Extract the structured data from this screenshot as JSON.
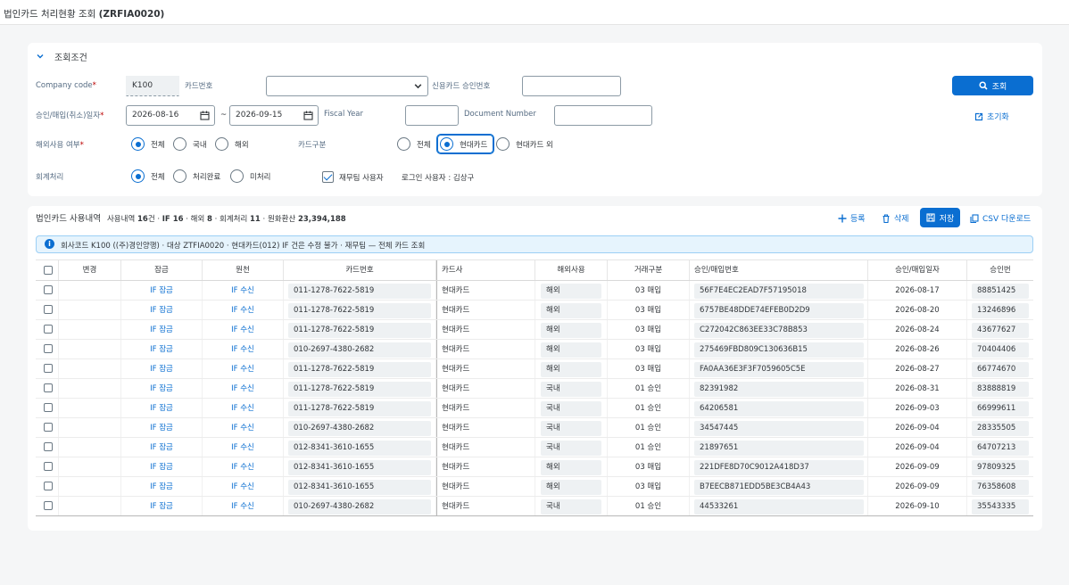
{
  "title": {
    "main": "법인카드 처리현황 조회",
    "code": "(ZRFIA0020)"
  },
  "filter": {
    "section_title": "조회조건",
    "company_label": "Company code",
    "company_value": "K100",
    "card_no_label": "카드번호",
    "card_no_value": "",
    "approval_label": "신용카드 승인번호",
    "approval_value": "",
    "date_label": "승인/매입(취소)일자",
    "date_from": "2026-08-16",
    "date_sep": "~",
    "date_to": "2026-09-15",
    "fiscal_label": "Fiscal Year",
    "fiscal_value": "",
    "docno_label": "Document Number",
    "docno_value": "",
    "overseas_label": "해외사용 여부",
    "overseas_options": [
      "전체",
      "국내",
      "해외"
    ],
    "overseas_selected": "전체",
    "cardtype_label": "카드구분",
    "cardtype_options": [
      "전체",
      "현대카드",
      "현대카드 외"
    ],
    "cardtype_selected": "현대카드",
    "acct_label": "회계처리",
    "acct_options": [
      "전체",
      "처리완료",
      "미처리"
    ],
    "acct_selected": "전체",
    "finance_user_label": "재무팀 사용자",
    "finance_user_checked": true,
    "login_user": "로그인 사용자 : 김상구",
    "search_btn": "조회",
    "reset_btn": "초기화"
  },
  "list": {
    "title": "법인카드 사용내역",
    "summary": {
      "t1": "사용내역 ",
      "total": "16",
      "t2": "건 · ",
      "if_label": "IF ",
      "if_count": "16",
      "t3": " · 해외 ",
      "overseas_count": "8",
      "t4": " · 회계처리 ",
      "acct_count": "11",
      "t5": " · 원화환산 ",
      "krw_total": "23,394,188"
    },
    "actions": {
      "add": "등록",
      "delete": "삭제",
      "save": "저장",
      "csv": "CSV 다운로드"
    },
    "info": "회사코드 K100 ((주)경인양행) · 대상 ZTFIA0020 · 현대카드(012) IF 건은 수정 불가 · 재무팀 — 전체 카드 조회",
    "columns": [
      "",
      "변경",
      "잠금",
      "원천",
      "카드번호",
      "카드사",
      "해외사용",
      "거래구분",
      "승인/매입번호",
      "승인/매입일자",
      "승인번"
    ],
    "rows": [
      {
        "lock": "IF 잠금",
        "src": "IF 수신",
        "card": "011-1278-7622-5819",
        "issuer": "현대카드",
        "ovs": "해외",
        "type": "03 매입",
        "apno": "56F7E4EC2EAD7F57195018",
        "date": "2026-08-17",
        "apv": "88851425"
      },
      {
        "lock": "IF 잠금",
        "src": "IF 수신",
        "card": "011-1278-7622-5819",
        "issuer": "현대카드",
        "ovs": "해외",
        "type": "03 매입",
        "apno": "6757BE48DDE74EFEB0D2D9",
        "date": "2026-08-20",
        "apv": "13246896"
      },
      {
        "lock": "IF 잠금",
        "src": "IF 수신",
        "card": "011-1278-7622-5819",
        "issuer": "현대카드",
        "ovs": "해외",
        "type": "03 매입",
        "apno": "C272042C863EE33C78B853",
        "date": "2026-08-24",
        "apv": "43677627"
      },
      {
        "lock": "IF 잠금",
        "src": "IF 수신",
        "card": "010-2697-4380-2682",
        "issuer": "현대카드",
        "ovs": "해외",
        "type": "03 매입",
        "apno": "275469FBD809C130636B15",
        "date": "2026-08-26",
        "apv": "70404406"
      },
      {
        "lock": "IF 잠금",
        "src": "IF 수신",
        "card": "011-1278-7622-5819",
        "issuer": "현대카드",
        "ovs": "해외",
        "type": "03 매입",
        "apno": "FA0AA36E3F3F7059605C5E",
        "date": "2026-08-27",
        "apv": "66774670"
      },
      {
        "lock": "IF 잠금",
        "src": "IF 수신",
        "card": "011-1278-7622-5819",
        "issuer": "현대카드",
        "ovs": "국내",
        "type": "01 승인",
        "apno": "82391982",
        "date": "2026-08-31",
        "apv": "83888819"
      },
      {
        "lock": "IF 잠금",
        "src": "IF 수신",
        "card": "011-1278-7622-5819",
        "issuer": "현대카드",
        "ovs": "국내",
        "type": "01 승인",
        "apno": "64206581",
        "date": "2026-09-03",
        "apv": "66999611"
      },
      {
        "lock": "IF 잠금",
        "src": "IF 수신",
        "card": "010-2697-4380-2682",
        "issuer": "현대카드",
        "ovs": "국내",
        "type": "01 승인",
        "apno": "34547445",
        "date": "2026-09-04",
        "apv": "28335505"
      },
      {
        "lock": "IF 잠금",
        "src": "IF 수신",
        "card": "012-8341-3610-1655",
        "issuer": "현대카드",
        "ovs": "국내",
        "type": "01 승인",
        "apno": "21897651",
        "date": "2026-09-04",
        "apv": "64707213"
      },
      {
        "lock": "IF 잠금",
        "src": "IF 수신",
        "card": "012-8341-3610-1655",
        "issuer": "현대카드",
        "ovs": "해외",
        "type": "03 매입",
        "apno": "221DFE8D70C9012A418D37",
        "date": "2026-09-09",
        "apv": "97809325"
      },
      {
        "lock": "IF 잠금",
        "src": "IF 수신",
        "card": "012-8341-3610-1655",
        "issuer": "현대카드",
        "ovs": "해외",
        "type": "03 매입",
        "apno": "B7EECB871EDD5BE3CB4A43",
        "date": "2026-09-09",
        "apv": "76358608"
      },
      {
        "lock": "IF 잠금",
        "src": "IF 수신",
        "card": "010-2697-4380-2682",
        "issuer": "현대카드",
        "ovs": "국내",
        "type": "01 승인",
        "apno": "44533261",
        "date": "2026-09-10",
        "apv": "35543335"
      }
    ]
  },
  "colors": {
    "accent": "#0a6ed1",
    "info_bg": "#e6f4fd",
    "required": "#bb0000"
  },
  "icons": {
    "section": "chevron-down-icon",
    "search": "search-icon",
    "reset": "reset-icon",
    "calendar": "calendar-icon",
    "add": "plus-icon",
    "delete": "trash-icon",
    "save": "save-icon",
    "csv": "csv-icon",
    "info": "info-icon"
  }
}
